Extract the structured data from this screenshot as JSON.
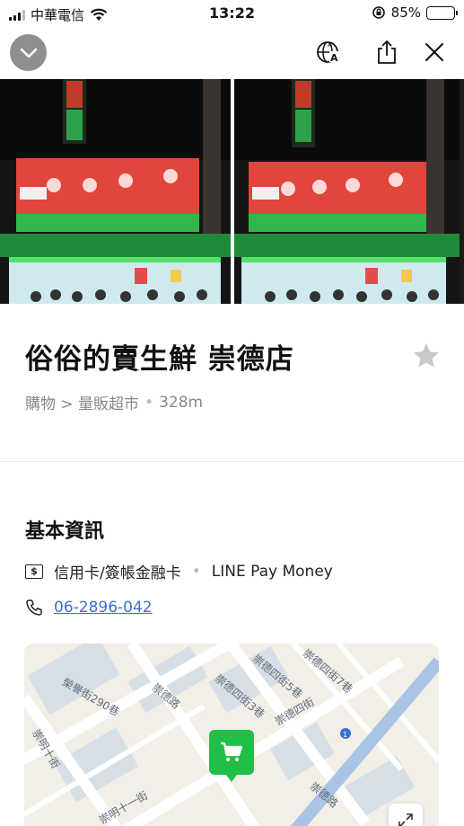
{
  "status_bar": {
    "carrier": "中華電信",
    "time": "13:22",
    "battery_percent": "85%",
    "battery_level": 0.85
  },
  "nav": {
    "icons": [
      "chevron-down-icon",
      "translate-icon",
      "share-icon",
      "close-icon"
    ]
  },
  "place": {
    "title": "俗俗的賣生鮮 崇德店",
    "category": "購物 > 量販超市",
    "distance": "328m"
  },
  "basic_info": {
    "heading": "基本資訊",
    "payment_methods": "信用卡/簽帳金融卡",
    "payment_extra": "LINE Pay Money",
    "phone": "06-2896-042"
  },
  "map": {
    "labels": [
      "榮譽街290巷",
      "崇德路",
      "崇德四街3巷",
      "崇德四街5巷",
      "崇德四街7巷",
      "崇明十街",
      "崇明十一街",
      "崇德四街",
      "崇德路",
      "1"
    ]
  },
  "colors": {
    "accent_green": "#1fbf48",
    "link_blue": "#3b6fd4",
    "collapse_gray": "#8f8f8f"
  }
}
